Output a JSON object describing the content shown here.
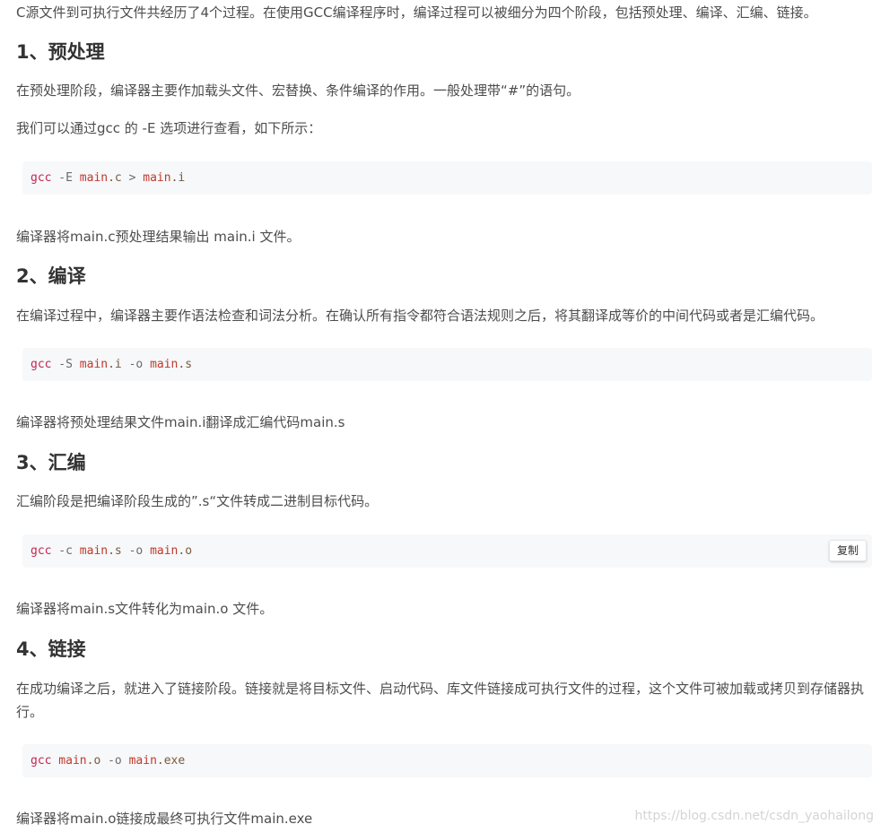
{
  "intro": "C源文件到可执行文件共经历了4个过程。在使用GCC编译程序时，编译过程可以被细分为四个阶段，包括预处理、编译、汇编、链接。",
  "sections": [
    {
      "heading": "1、预处理",
      "paragraphs": [
        "在预处理阶段，编译器主要作加载头文件、宏替换、条件编译的作用。一般处理带“#”的语句。",
        "我们可以通过gcc 的 -E 选项进行查看，如下所示："
      ],
      "code": {
        "tokens": [
          "gcc",
          " -E ",
          "main",
          ".c",
          " > ",
          "main",
          ".i"
        ]
      },
      "after": "编译器将main.c预处理结果输出 main.i 文件。"
    },
    {
      "heading": "2、编译",
      "paragraphs": [
        "在编译过程中，编译器主要作语法检查和词法分析。在确认所有指令都符合语法规则之后，将其翻译成等价的中间代码或者是汇编代码。"
      ],
      "code": {
        "tokens": [
          "gcc",
          " -S ",
          "main",
          ".i",
          " -o ",
          "main",
          ".s"
        ]
      },
      "after": "编译器将预处理结果文件main.i翻译成汇编代码main.s"
    },
    {
      "heading": "3、汇编",
      "paragraphs": [
        "汇编阶段是把编译阶段生成的”.s“文件转成二进制目标代码。"
      ],
      "code": {
        "tokens": [
          "gcc",
          " -c ",
          "main",
          ".s",
          " -o ",
          "main",
          ".o"
        ],
        "copy_label": "复制"
      },
      "after": "编译器将main.s文件转化为main.o 文件。"
    },
    {
      "heading": "4、链接",
      "paragraphs": [
        "在成功编译之后，就进入了链接阶段。链接就是将目标文件、启动代码、库文件链接成可执行文件的过程，这个文件可被加载或拷贝到存储器执行。"
      ],
      "code": {
        "tokens": [
          "gcc",
          " main",
          ".o",
          " -o ",
          "main",
          ".exe"
        ]
      },
      "after": "编译器将main.o链接成最终可执行文件main.exe"
    }
  ],
  "watermark": "https://blog.csdn.net/csdn_yaohailong",
  "colors": {
    "text": "#4d4d4d",
    "heading": "#333333",
    "code_bg": "#f6f8fa",
    "code_cmd": "#c7254e",
    "watermark": "#d4d4d4"
  }
}
